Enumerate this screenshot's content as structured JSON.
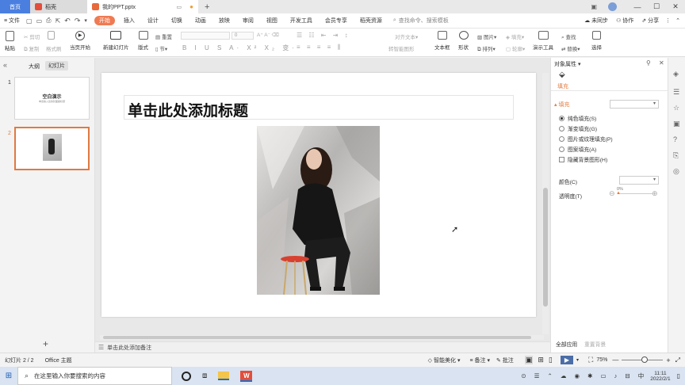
{
  "titlebar": {
    "tabs": [
      "首页",
      "稻壳",
      "我的PPT.pptx"
    ],
    "new_tab": "+",
    "window_controls": [
      "—",
      "☐",
      "✕"
    ]
  },
  "menubar": {
    "file_label": "≡ 文件",
    "items": [
      "开始",
      "插入",
      "设计",
      "切换",
      "动画",
      "放映",
      "审阅",
      "视图",
      "开发工具",
      "会员专享",
      "稻壳资源"
    ],
    "search_placeholder": "查找命令、搜索模板",
    "right": [
      "未同步",
      "协作",
      "分享"
    ]
  },
  "ribbon": {
    "paste": "粘贴",
    "cut": "剪切",
    "copy": "复制",
    "format_painter": "格式刷",
    "from_current": "当页开始",
    "new_slide": "新建幻灯片",
    "layout": "版式",
    "section": "节",
    "reset": "重置",
    "font_size": "0",
    "textbox": "文本框",
    "shape": "形状",
    "arrange": "排列",
    "picture": "图片",
    "fill": "填充",
    "outline": "轮廓",
    "align_text": "对齐文本",
    "smartart": "转智能图形",
    "presenter_tools": "演示工具",
    "find": "查找",
    "replace": "替换",
    "select": "选择"
  },
  "leftpanel": {
    "tabs": [
      "大纲",
      "幻灯片"
    ],
    "slides": [
      {
        "num": "1",
        "title": "空白演示",
        "subtitle": "单击输入您的封面副标题"
      },
      {
        "num": "2"
      }
    ],
    "add_slide": "+"
  },
  "slide": {
    "title_placeholder": "单击此处添加标题"
  },
  "notes": {
    "placeholder": "单击此处添加备注"
  },
  "rightpanel": {
    "header": "对象属性 ▾",
    "tab": "填充",
    "fill_section": "填充",
    "options": [
      "纯色填充(S)",
      "渐变填充(G)",
      "图片或纹理填充(P)",
      "图案填充(A)"
    ],
    "checkbox": "隐藏背景图形(H)",
    "color_label": "颜色(C)",
    "transparency_label": "透明度(T)",
    "transparency_value": "0%",
    "apply_all": "全部应用",
    "reset_bg": "重置背景"
  },
  "statusbar": {
    "slide_count": "幻灯片 2 / 2",
    "theme": "Office 主题",
    "beautify": "智能美化",
    "notes": "备注",
    "comments": "批注",
    "zoom": "75%"
  },
  "taskbar": {
    "search_placeholder": "在这里输入你要搜索的内容",
    "ime": "中",
    "time": "11:11",
    "date": "2022/2/1"
  },
  "colors": {
    "accent": "#f07a52",
    "home_tab": "#4a7fe0",
    "wps_red": "#e34d3a"
  }
}
